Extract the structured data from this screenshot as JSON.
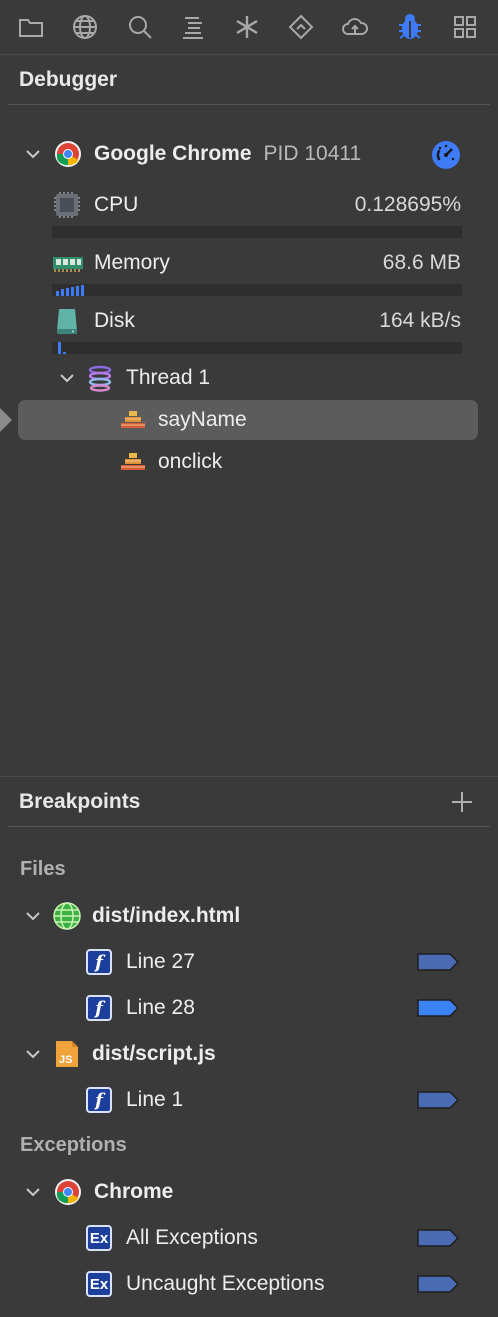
{
  "toolbar": {
    "icons": [
      "folder-icon",
      "globe-icon",
      "search-icon",
      "outline-icon",
      "asterisk-icon",
      "diamond-icon",
      "cloud-upload-icon",
      "bug-icon",
      "grid-icon"
    ],
    "active_index": 7,
    "active_color": "#3d7bf7"
  },
  "debugger": {
    "title": "Debugger",
    "process": {
      "name": "Google Chrome",
      "pid": "PID 10411"
    },
    "cpu": {
      "label": "CPU",
      "value": "0.128695%",
      "level": 0.0013
    },
    "memory": {
      "label": "Memory",
      "value": "68.6 MB"
    },
    "disk": {
      "label": "Disk",
      "value": "164 kB/s"
    },
    "thread": {
      "label": "Thread 1"
    },
    "frames": [
      {
        "label": "sayName",
        "selected": true
      },
      {
        "label": "onclick",
        "selected": false
      }
    ]
  },
  "breakpoints": {
    "title": "Breakpoints",
    "files_heading": "Files",
    "files": [
      {
        "name": "dist/index.html",
        "lines": [
          {
            "label": "Line 27",
            "active": false
          },
          {
            "label": "Line 28",
            "active": true
          }
        ]
      },
      {
        "name": "dist/script.js",
        "lines": [
          {
            "label": "Line 1",
            "active": false
          }
        ]
      }
    ],
    "exceptions_heading": "Exceptions",
    "exceptions_group": "Chrome",
    "exceptions": [
      {
        "label": "All Exceptions",
        "badge": "Ex"
      },
      {
        "label": "Uncaught Exceptions",
        "badge": "Ex"
      }
    ]
  },
  "colors": {
    "accent": "#3d7bf7",
    "flag_inactive": "#4a6bb3",
    "flag_active": "#3b82f6"
  }
}
